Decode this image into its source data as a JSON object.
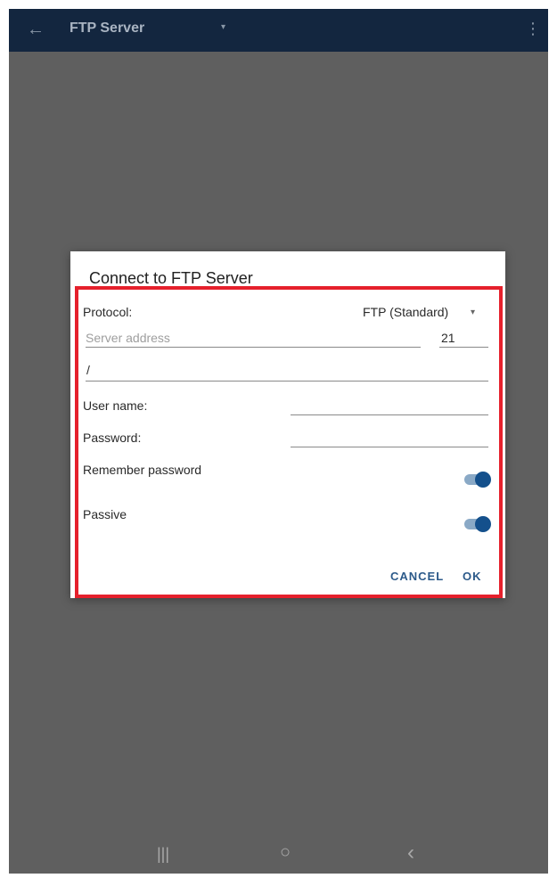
{
  "appbar": {
    "title": "FTP Server",
    "back_icon": "←",
    "dropdown_icon": "▾",
    "more_icon": "⋮"
  },
  "dialog": {
    "title": "Connect to FTP Server",
    "protocol": {
      "label": "Protocol:",
      "value": "FTP (Standard)",
      "arrow": "▾"
    },
    "server": {
      "placeholder": "Server address",
      "port": "21"
    },
    "path": {
      "value": "/"
    },
    "username": {
      "label": "User name:",
      "value": ""
    },
    "password": {
      "label": "Password:",
      "value": ""
    },
    "remember": {
      "label": "Remember password",
      "on": true
    },
    "passive": {
      "label": "Passive",
      "on": true
    },
    "buttons": {
      "cancel": "CANCEL",
      "ok": "OK"
    }
  },
  "navbar": {
    "recent": "|||",
    "home": "○",
    "back": "‹"
  },
  "colors": {
    "accent": "#14508c",
    "highlight": "#e5202c",
    "appbar": "#13263f"
  }
}
